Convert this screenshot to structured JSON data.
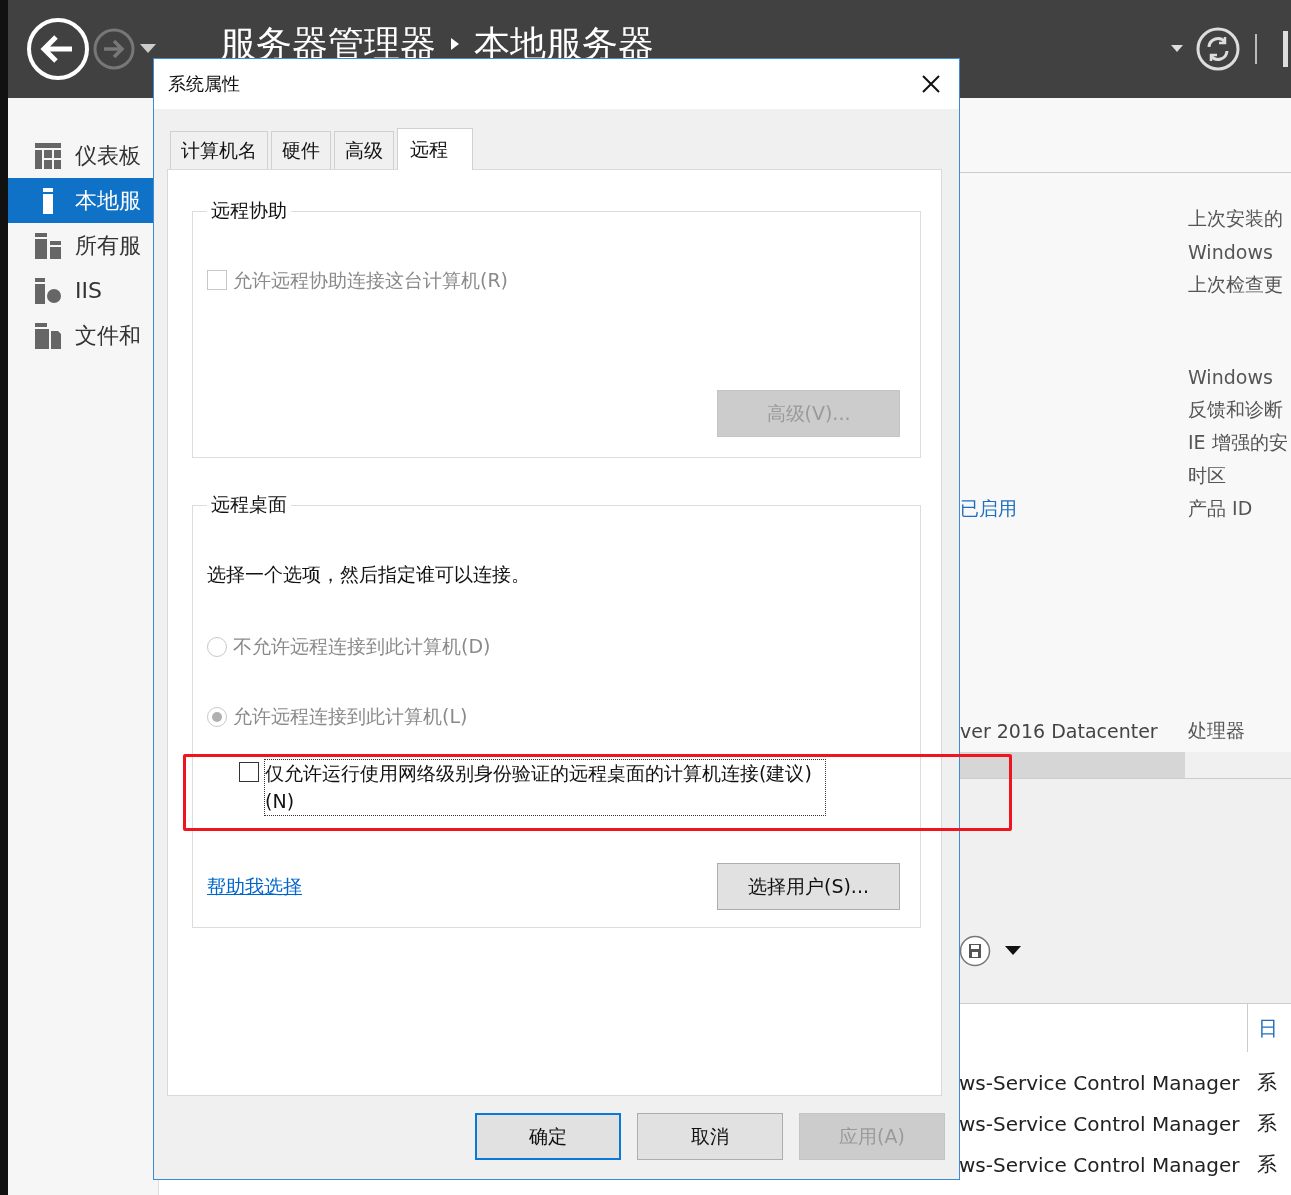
{
  "header": {
    "breadcrumb": [
      "服务器管理器",
      "本地服务器"
    ]
  },
  "sidebar": {
    "items": [
      {
        "label": "仪表板",
        "kind": "dashboard",
        "selected": false
      },
      {
        "label": "本地服",
        "kind": "server",
        "selected": true
      },
      {
        "label": "所有服",
        "kind": "servers",
        "selected": false
      },
      {
        "label": "IIS",
        "kind": "iis",
        "selected": false
      },
      {
        "label": "文件和",
        "kind": "files",
        "selected": false
      }
    ]
  },
  "properties": {
    "groups": [
      [
        {
          "label": "上次安装的"
        },
        {
          "label": "Windows"
        },
        {
          "label": "上次检查更"
        }
      ],
      [
        {
          "label": "Windows"
        },
        {
          "label": "反馈和诊断"
        },
        {
          "label": "IE 增强的安"
        },
        {
          "label": "时区"
        },
        {
          "value": "已启用",
          "label": "产品 ID"
        }
      ]
    ],
    "hardware": {
      "value": "ver 2016 Datacenter",
      "label": "处理器"
    }
  },
  "events": {
    "columns": [
      "",
      "日"
    ],
    "rows": [
      [
        "ws-Service Control Manager",
        "系"
      ],
      [
        "ws-Service Control Manager",
        "系"
      ],
      [
        "ws-Service Control Manager",
        "系"
      ]
    ]
  },
  "dialog": {
    "title": "系统属性",
    "tabs": [
      {
        "label": "计算机名",
        "selected": false
      },
      {
        "label": "硬件",
        "selected": false
      },
      {
        "label": "高级",
        "selected": false
      },
      {
        "label": "远程",
        "selected": true
      }
    ],
    "remote_assistance": {
      "title": "远程协助",
      "checkbox": {
        "label": "允许远程协助连接这台计算机(R)",
        "checked": false,
        "disabled": true
      },
      "advanced_button": {
        "label": "高级(V)...",
        "disabled": true
      }
    },
    "remote_desktop": {
      "title": "远程桌面",
      "instruction": "选择一个选项，然后指定谁可以连接。",
      "options": [
        {
          "label": "不允许远程连接到此计算机(D)",
          "selected": false,
          "disabled": true
        },
        {
          "label": "允许远程连接到此计算机(L)",
          "selected": true,
          "disabled": true
        }
      ],
      "nla": {
        "label": "仅允许运行使用网络级别身份验证的远程桌面的计算机连接(建议)(N)",
        "checked": false,
        "focused": true
      },
      "help_link": "帮助我选择",
      "select_users_button": {
        "label": "选择用户(S)...",
        "disabled": false
      }
    },
    "buttons": [
      {
        "label": "确定",
        "default": true,
        "disabled": false
      },
      {
        "label": "取消",
        "default": false,
        "disabled": false
      },
      {
        "label": "应用(A)",
        "default": false,
        "disabled": true
      }
    ]
  }
}
